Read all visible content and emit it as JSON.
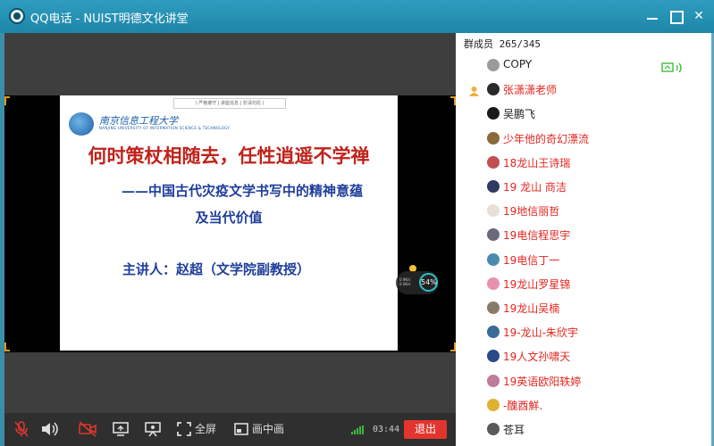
{
  "window": {
    "title": "QQ电话 - NUIST明德文化讲堂",
    "accent": "#1d86a8"
  },
  "slide": {
    "top_label": "( 严格遵守 | 讲座信息 | 非请勿扰 )",
    "university_cn": "南京信息工程大学",
    "university_en": "NANJING UNIVERSITY OF INFORMATION SCIENCE & TECHNOLOGY",
    "title": "何时策杖相随去，任性逍遥不学禅",
    "subtitle_line1": "——中国古代灾疫文学书写中的精神意蕴",
    "subtitle_line2": "及当代价值",
    "speaker": "主讲人：赵超（文学院副教授）"
  },
  "float_widget": {
    "line1": "0.9K/s",
    "line2": "0.0K/s",
    "percent": "54%"
  },
  "controls": {
    "fullscreen_label": "全屏",
    "pip_label": "画中画",
    "timer": "03:44",
    "exit_label": "退出"
  },
  "members": {
    "header": "群成员 265/345",
    "list": [
      {
        "name": "COPY",
        "color": "black",
        "avatar": "#9a9a9a"
      },
      {
        "name": "张潇潇老师",
        "color": "red",
        "avatar": "#2a2a2a",
        "owner": true
      },
      {
        "name": "吴鹏飞",
        "color": "black",
        "avatar": "#1a1a1a"
      },
      {
        "name": "少年他的奇幻漂流",
        "color": "red",
        "avatar": "#8a6a3a"
      },
      {
        "name": "18龙山王诗瑞",
        "color": "red",
        "avatar": "#c05050"
      },
      {
        "name": "19  龙山  商洁",
        "color": "red",
        "avatar": "#303a60"
      },
      {
        "name": "19地信丽哲",
        "color": "red",
        "avatar": "#e8e0d8"
      },
      {
        "name": "19电信程思宇",
        "color": "red",
        "avatar": "#6a6a7a"
      },
      {
        "name": "19电信丁一",
        "color": "red",
        "avatar": "#4a8ab0"
      },
      {
        "name": "19龙山罗星锦",
        "color": "red",
        "avatar": "#e890b0"
      },
      {
        "name": "19龙山吴楠",
        "color": "red",
        "avatar": "#8a7a6a"
      },
      {
        "name": "19-龙山-朱欣宇",
        "color": "red",
        "avatar": "#3a6a9a"
      },
      {
        "name": "19人文孙啸天",
        "color": "red",
        "avatar": "#2a4a8a"
      },
      {
        "name": "19英语欧阳轶婷",
        "color": "red",
        "avatar": "#c07a9a"
      },
      {
        "name": "-醜酉鮮.",
        "color": "red",
        "avatar": "#e0b030"
      },
      {
        "name": "苍耳",
        "color": "black",
        "avatar": "#5a5a5a"
      }
    ]
  }
}
